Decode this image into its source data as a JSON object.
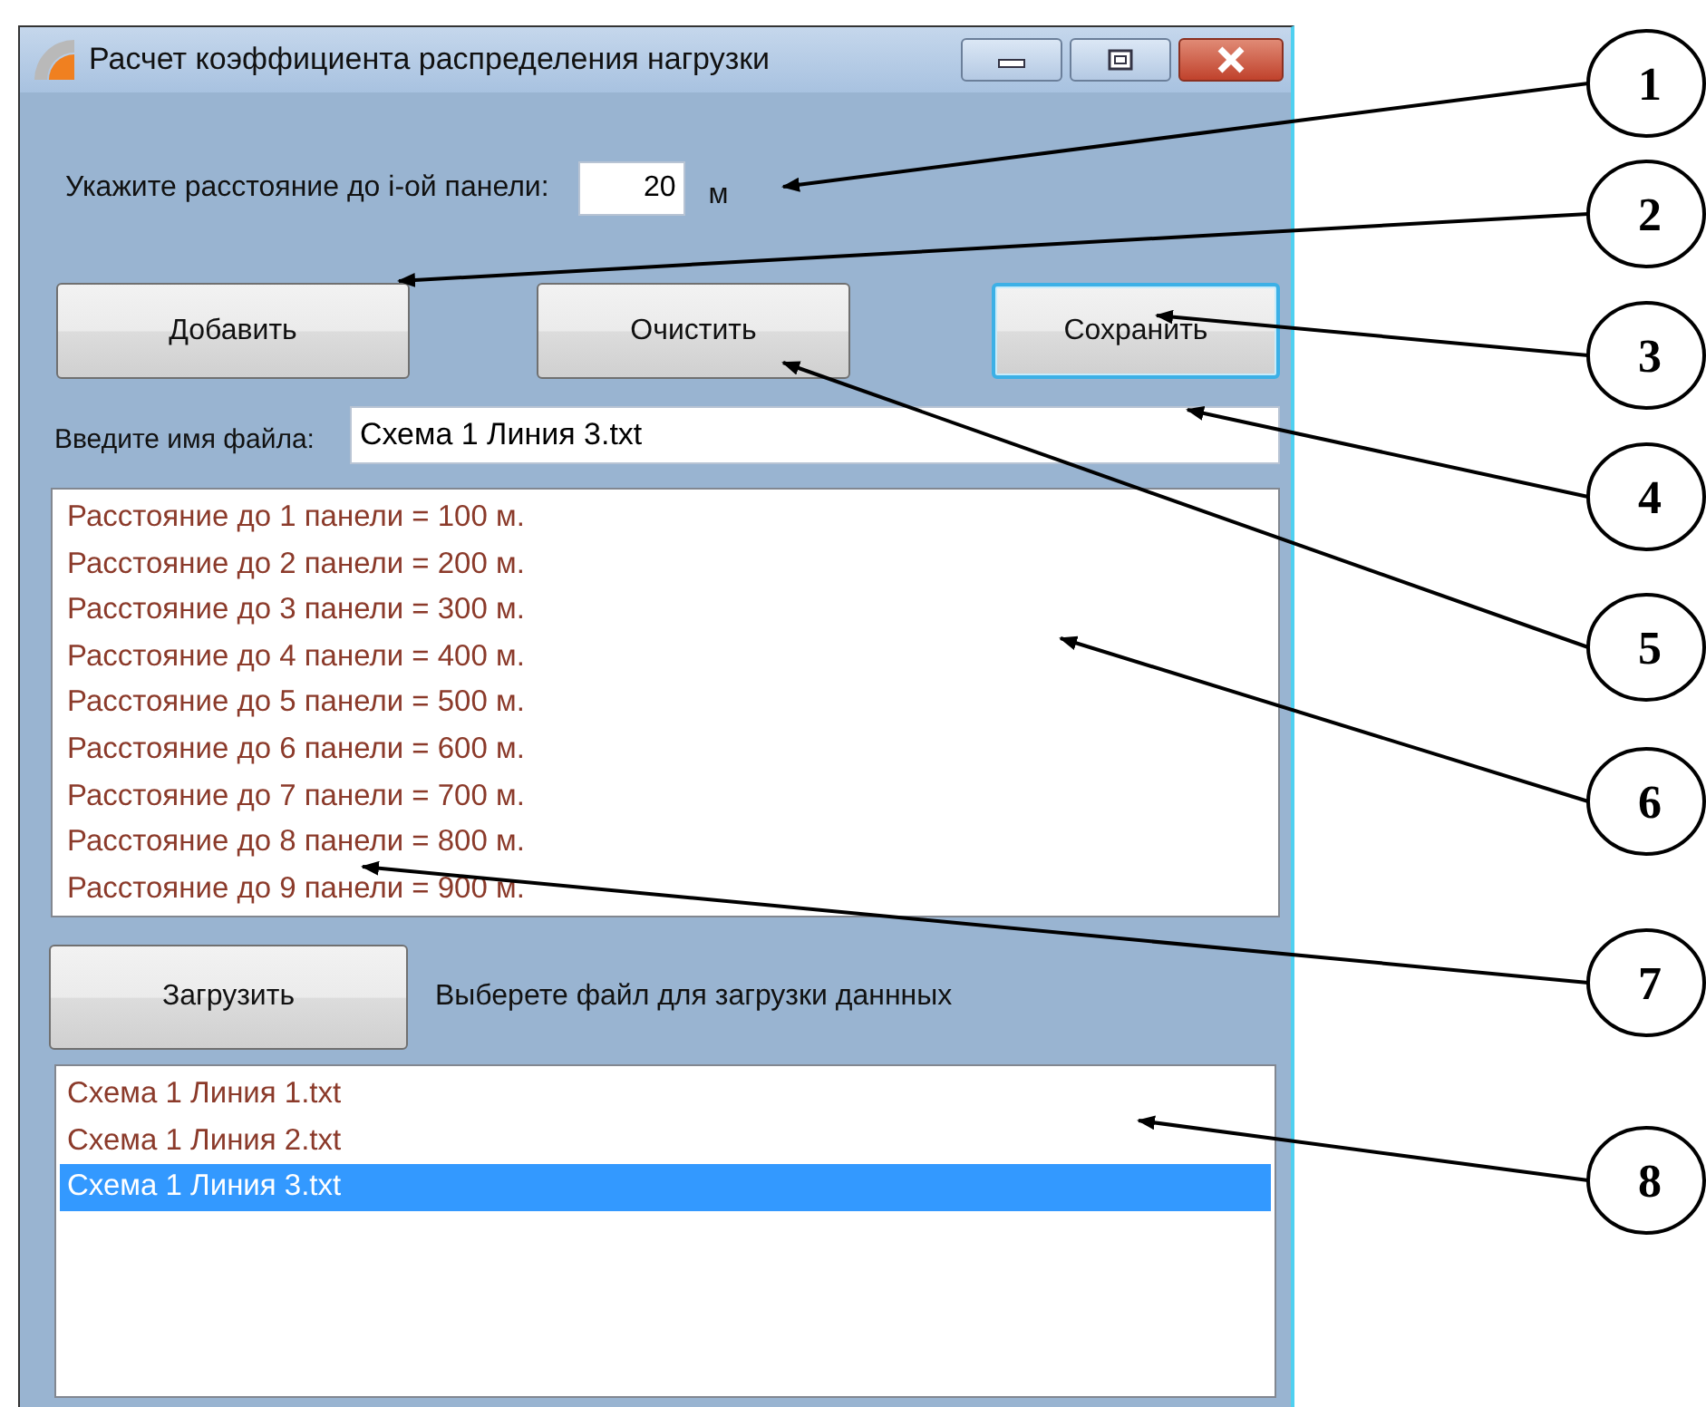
{
  "window": {
    "title": "Расчет коэффициента распределения нагрузки"
  },
  "distance": {
    "label": "Укажите расстояние до i-ой панели:",
    "value": "20",
    "unit": "м"
  },
  "buttons": [
    {
      "label": "Добавить",
      "focused": false
    },
    {
      "label": "Очистить",
      "focused": false
    },
    {
      "label": "Сохранить",
      "focused": true
    }
  ],
  "file_name": {
    "label": "Введите имя файла:",
    "value": "Схема 1 Линия 3.txt"
  },
  "distances_list": [
    "Расстояние до 1 панели = 100 м.",
    "Расстояние до 2 панели = 200 м.",
    "Расстояние до 3 панели = 300 м.",
    "Расстояние до 4 панели = 400 м.",
    "Расстояние до 5 панели = 500 м.",
    "Расстояние до 6 панели = 600 м.",
    "Расстояние до 7 панели = 700 м.",
    "Расстояние до 8 панели = 800 м.",
    "Расстояние до 9 панели = 900 м."
  ],
  "load": {
    "button": "Загрузить",
    "hint": "Выберете файл для загрузки даннных"
  },
  "files_list": [
    {
      "label": "Схема 1 Линия 1.txt",
      "selected": false
    },
    {
      "label": "Схема 1 Линия 2.txt",
      "selected": false
    },
    {
      "label": "Схема 1 Линия 3.txt",
      "selected": true
    }
  ],
  "callouts": [
    "1",
    "2",
    "3",
    "4",
    "5",
    "6",
    "7",
    "8"
  ]
}
